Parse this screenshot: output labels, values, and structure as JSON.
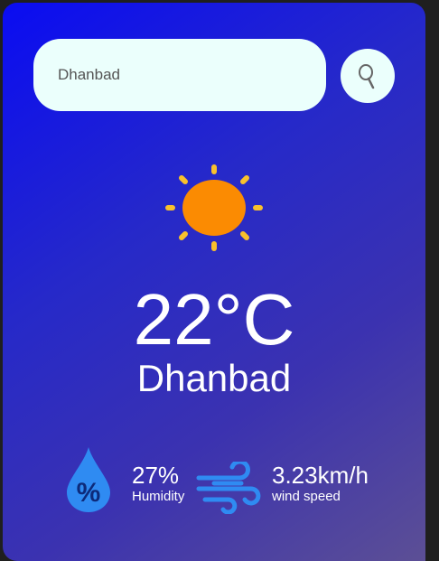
{
  "search": {
    "value": "Dhanbad"
  },
  "weather": {
    "temperature": "22°C",
    "city": "Dhanbad",
    "condition_icon": "sun-icon"
  },
  "details": {
    "humidity_value": "27%",
    "humidity_label": "Humidity",
    "wind_value": "3.23km/h",
    "wind_label": "wind speed"
  },
  "colors": {
    "gradient_start": "#0a0cf2",
    "gradient_end": "#5c4f95",
    "search_bg": "#ebfffc",
    "sun_body": "#fb8b02",
    "sun_rays": "#f9c12c",
    "stat_icon": "#2f8bf2"
  }
}
